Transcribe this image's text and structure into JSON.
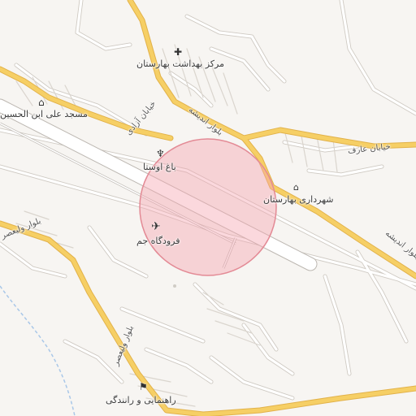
{
  "map": {
    "pois": [
      {
        "id": "health",
        "label": "مرکز بهداشت بهارستان",
        "icon": "cross-icon",
        "glyph": "✚"
      },
      {
        "id": "mosque",
        "label": "مسجد علی ابن الحسین",
        "icon": "mosque-icon",
        "glyph": "⌂"
      },
      {
        "id": "garden",
        "label": "باغ اوستا",
        "icon": "garden-icon",
        "glyph": "♆"
      },
      {
        "id": "municipality",
        "label": "شهرداری بهارستان",
        "icon": "government-building-icon",
        "glyph": "🏛"
      },
      {
        "id": "airport",
        "label": "فرودگاه جم",
        "icon": "airplane-icon",
        "glyph": "✈"
      },
      {
        "id": "driving",
        "label": "راهنمایی و رانندگی",
        "icon": "police-icon",
        "glyph": "⚑"
      }
    ],
    "roads": [
      {
        "id": "azadi",
        "label": "خیابان آزادی"
      },
      {
        "id": "andisheh-north",
        "label": "بلوار اندیشه"
      },
      {
        "id": "aref",
        "label": "خیابان عارف"
      },
      {
        "id": "andisheh-east",
        "label": "بلوار اندیشه"
      },
      {
        "id": "valiasr-west",
        "label": "بلوار ولیعصر"
      },
      {
        "id": "valiasr-south",
        "label": "بلوار ولیعصر"
      }
    ],
    "colors": {
      "background": "#f7f5f2",
      "major_road": "#f6cf65",
      "major_road_casing": "#e2b24a",
      "minor_road": "#ffffff",
      "minor_casing": "#cfcac3",
      "runway": "#ffffff",
      "runway_casing": "#bdb8b2",
      "highlight_fill": "#f5a3ad",
      "highlight_stroke": "#e38a95",
      "water": "#a9c7e8"
    }
  }
}
